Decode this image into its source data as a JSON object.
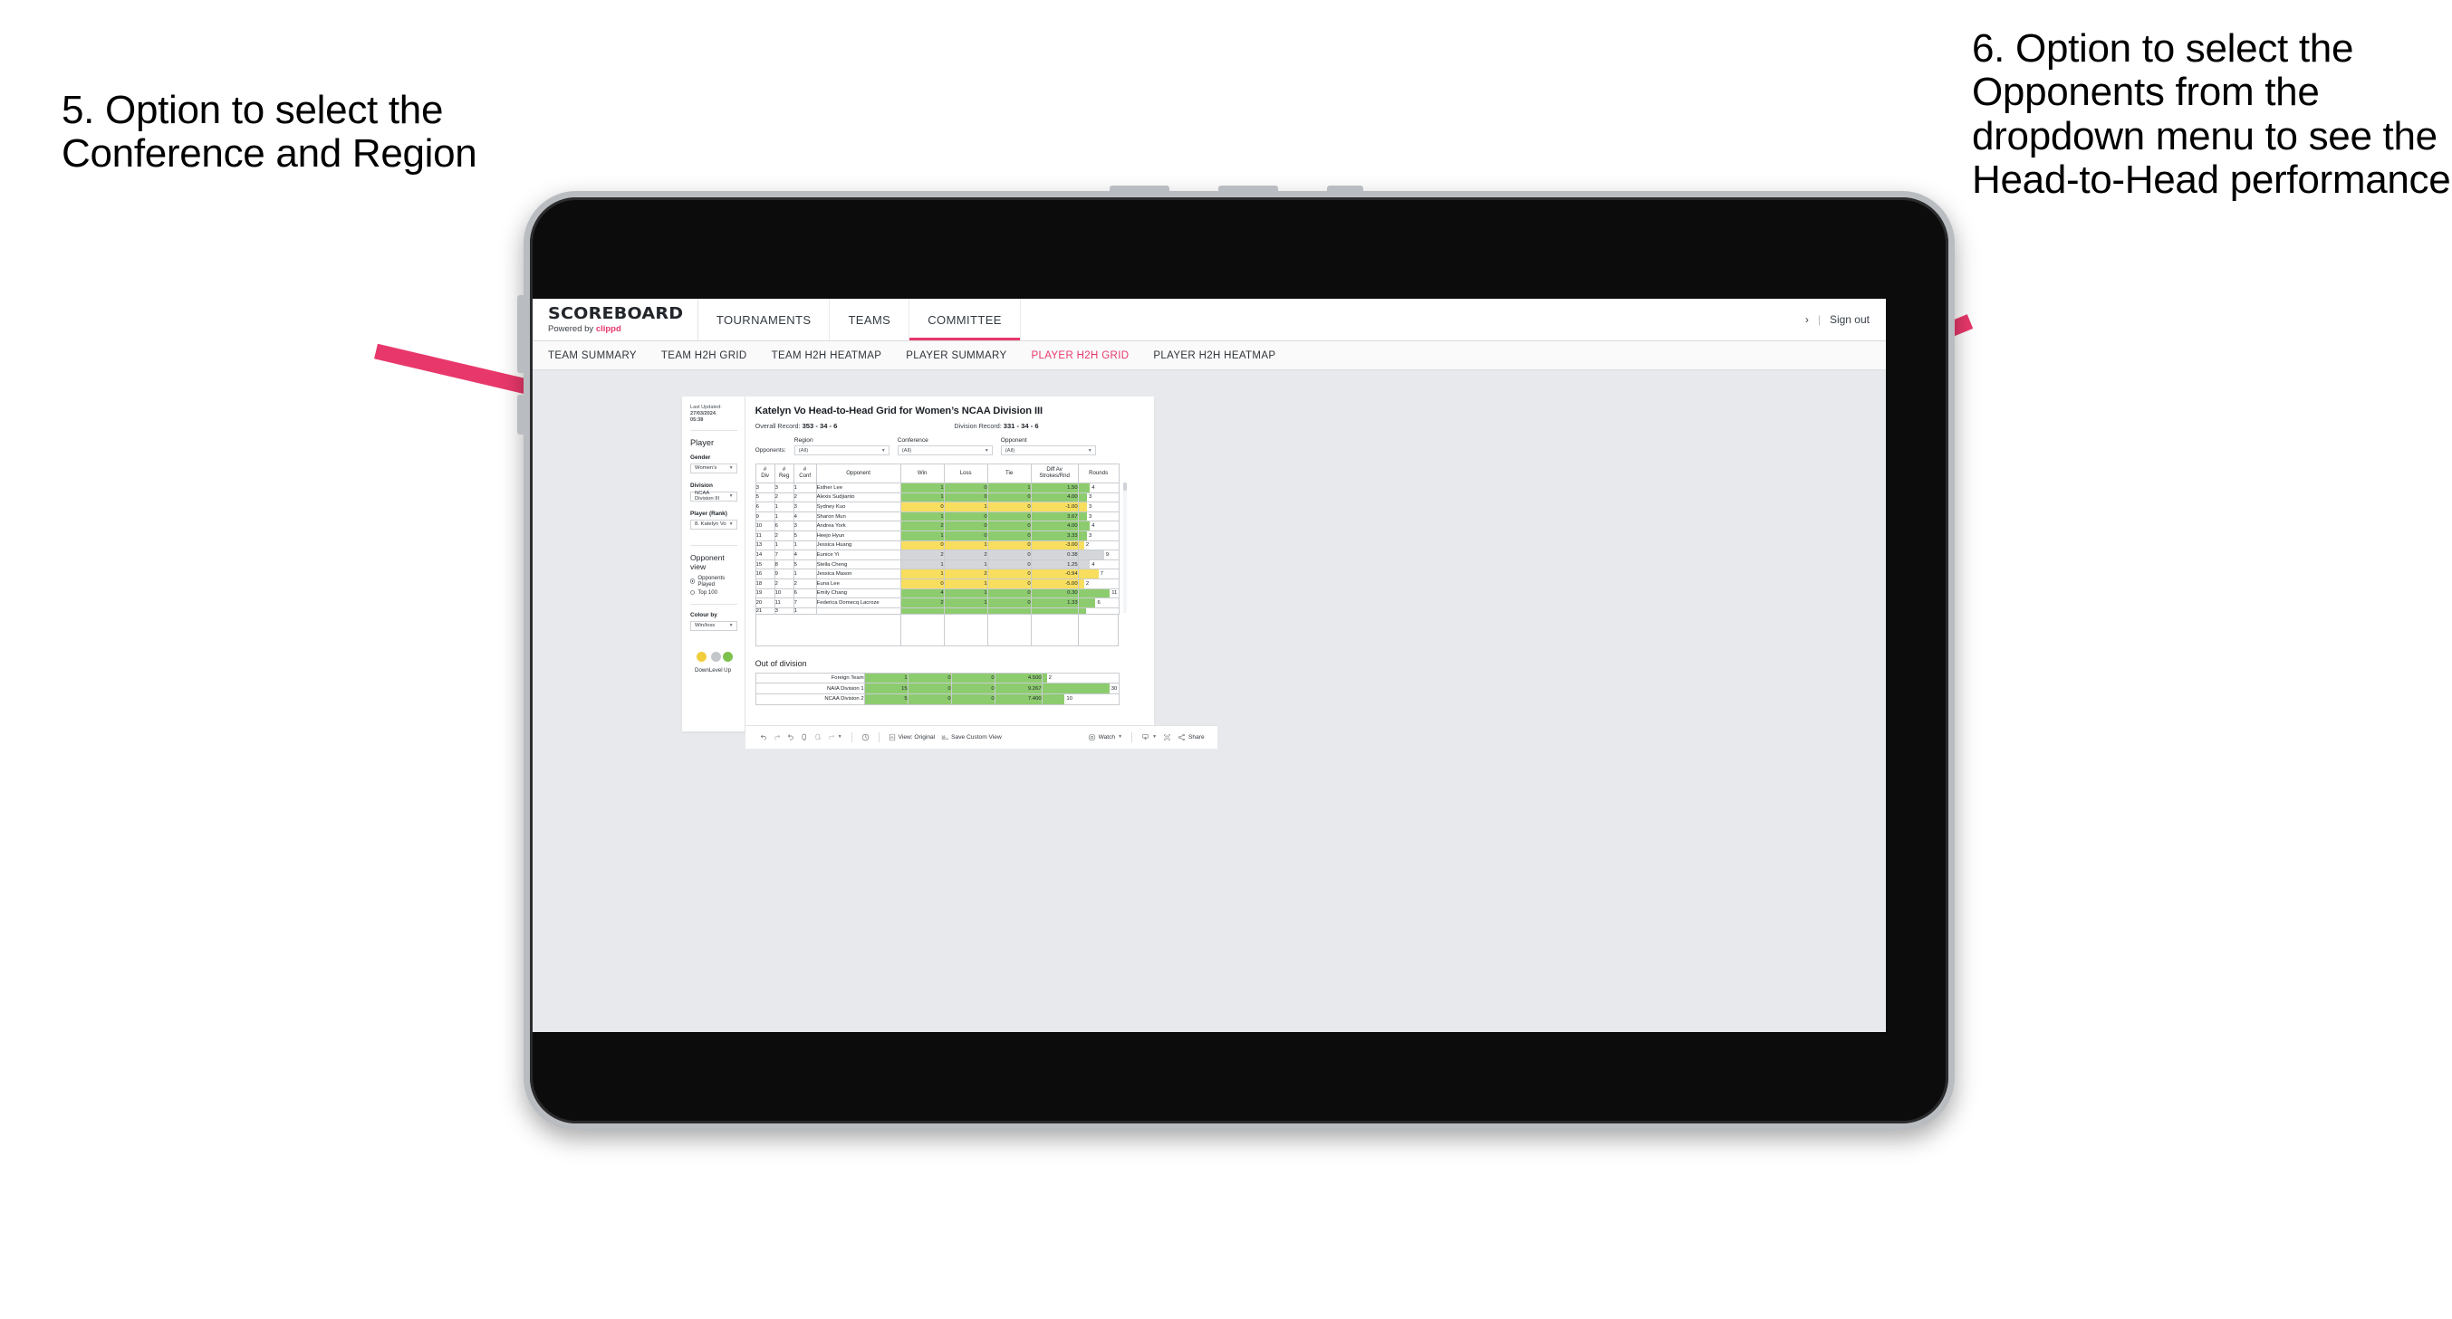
{
  "annotations": {
    "left": "5. Option to select the Conference and Region",
    "right": "6. Option to select the Opponents from the dropdown menu to see the Head-to-Head performance",
    "arrow_color": "#E8386B"
  },
  "app": {
    "brand": {
      "name": "SCOREBOARD",
      "powered_prefix": "Powered by ",
      "powered_brand": "clippd"
    },
    "topnav": [
      {
        "label": "TOURNAMENTS",
        "active": false
      },
      {
        "label": "TEAMS",
        "active": false
      },
      {
        "label": "COMMITTEE",
        "active": true
      }
    ],
    "topright": {
      "chevron": "›",
      "separator": "|",
      "signout": "Sign out"
    },
    "subnav": [
      {
        "label": "TEAM SUMMARY",
        "active": false
      },
      {
        "label": "TEAM H2H GRID",
        "active": false
      },
      {
        "label": "TEAM H2H HEATMAP",
        "active": false
      },
      {
        "label": "PLAYER SUMMARY",
        "active": false
      },
      {
        "label": "PLAYER H2H GRID",
        "active": true
      },
      {
        "label": "PLAYER H2H HEATMAP",
        "active": false
      }
    ]
  },
  "sidebar": {
    "last_updated_label": "Last Updated:",
    "last_updated_value": "27/03/2024",
    "last_updated_time": "05:38",
    "player_heading": "Player",
    "gender_label": "Gender",
    "gender_value": "Women’s",
    "division_label": "Division",
    "division_value": "NCAA Division III",
    "player_rank_label": "Player (Rank)",
    "player_rank_value": "8. Katelyn Vo",
    "opponent_view_heading": "Opponent view",
    "opponent_view_options": [
      {
        "label": "Opponents Played",
        "selected": true
      },
      {
        "label": "Top 100",
        "selected": false
      }
    ],
    "colour_by_label": "Colour by",
    "colour_by_value": "Win/loss",
    "legend": [
      {
        "label": "Down",
        "color": "#F2CE3E"
      },
      {
        "label": "Level",
        "color": "#C3C7CC"
      },
      {
        "label": "Up",
        "color": "#7DC24E"
      }
    ]
  },
  "main": {
    "title": "Katelyn Vo Head-to-Head Grid for Women’s NCAA Division III",
    "overall_record_label": "Overall Record:",
    "overall_record_value": "353 -  34 - 6",
    "division_record_label": "Division Record:",
    "division_record_value": "331 -  34 - 6",
    "opponents_label": "Opponents:",
    "filters": [
      {
        "label": "Region",
        "value": "(All)"
      },
      {
        "label": "Conference",
        "value": "(All)"
      },
      {
        "label": "Opponent",
        "value": "(All)"
      }
    ],
    "out_of_division_heading": "Out of division"
  },
  "chart_data": {
    "type": "table",
    "title": "Katelyn Vo Head-to-Head Grid for Women’s NCAA Division III",
    "columns": [
      "# Div",
      "# Reg",
      "# Conf",
      "Opponent",
      "Win",
      "Loss",
      "Tie",
      "Diff Av Strokes/Rnd",
      "Rounds"
    ],
    "header_lines": {
      "div": [
        "#",
        "Div"
      ],
      "reg": [
        "#",
        "Reg"
      ],
      "conf": [
        "#",
        "Conf"
      ],
      "opponent": [
        "Opponent"
      ],
      "win": [
        "Win"
      ],
      "loss": [
        "Loss"
      ],
      "tie": [
        "Tie"
      ],
      "diff": [
        "Diff Av",
        "Strokes/Rnd"
      ],
      "rounds": [
        "Rounds"
      ]
    },
    "rounds_max": 14,
    "rows": [
      {
        "div": "3",
        "reg": "3",
        "conf": "1",
        "opponent": "Esther Lee",
        "win": "1",
        "loss": "0",
        "tie": "1",
        "diff": "1.50",
        "rounds": "4",
        "rounds_num": 4,
        "state": "up"
      },
      {
        "div": "5",
        "reg": "2",
        "conf": "2",
        "opponent": "Alexis Sudjianto",
        "win": "1",
        "loss": "0",
        "tie": "0",
        "diff": "4.00",
        "rounds": "3",
        "rounds_num": 3,
        "state": "up"
      },
      {
        "div": "6",
        "reg": "1",
        "conf": "3",
        "opponent": "Sydney Kuo",
        "win": "0",
        "loss": "1",
        "tie": "0",
        "diff": "-1.00",
        "rounds": "3",
        "rounds_num": 3,
        "state": "down"
      },
      {
        "div": "9",
        "reg": "1",
        "conf": "4",
        "opponent": "Sharon Mun",
        "win": "1",
        "loss": "0",
        "tie": "0",
        "diff": "3.67",
        "rounds": "3",
        "rounds_num": 3,
        "state": "up"
      },
      {
        "div": "10",
        "reg": "6",
        "conf": "3",
        "opponent": "Andrea York",
        "win": "2",
        "loss": "0",
        "tie": "0",
        "diff": "4.00",
        "rounds": "4",
        "rounds_num": 4,
        "state": "up"
      },
      {
        "div": "11",
        "reg": "2",
        "conf": "5",
        "opponent": "Heejo Hyun",
        "win": "1",
        "loss": "0",
        "tie": "0",
        "diff": "3.33",
        "rounds": "3",
        "rounds_num": 3,
        "state": "up"
      },
      {
        "div": "13",
        "reg": "1",
        "conf": "1",
        "opponent": "Jessica Huang",
        "win": "0",
        "loss": "1",
        "tie": "0",
        "diff": "-3.00",
        "rounds": "2",
        "rounds_num": 2,
        "state": "down"
      },
      {
        "div": "14",
        "reg": "7",
        "conf": "4",
        "opponent": "Eunice Yi",
        "win": "2",
        "loss": "2",
        "tie": "0",
        "diff": "0.38",
        "rounds": "9",
        "rounds_num": 9,
        "state": "level"
      },
      {
        "div": "15",
        "reg": "8",
        "conf": "5",
        "opponent": "Stella Cheng",
        "win": "1",
        "loss": "1",
        "tie": "0",
        "diff": "1.25",
        "rounds": "4",
        "rounds_num": 4,
        "state": "level"
      },
      {
        "div": "16",
        "reg": "9",
        "conf": "1",
        "opponent": "Jessica Mason",
        "win": "1",
        "loss": "2",
        "tie": "0",
        "diff": "-0.94",
        "rounds": "7",
        "rounds_num": 7,
        "state": "down"
      },
      {
        "div": "18",
        "reg": "2",
        "conf": "2",
        "opponent": "Euna Lee",
        "win": "0",
        "loss": "1",
        "tie": "0",
        "diff": "-5.00",
        "rounds": "2",
        "rounds_num": 2,
        "state": "down"
      },
      {
        "div": "19",
        "reg": "10",
        "conf": "6",
        "opponent": "Emily Chang",
        "win": "4",
        "loss": "1",
        "tie": "0",
        "diff": "0.30",
        "rounds": "11",
        "rounds_num": 11,
        "state": "up"
      },
      {
        "div": "20",
        "reg": "11",
        "conf": "7",
        "opponent": "Federica Domecq Lacroze",
        "win": "2",
        "loss": "1",
        "tie": "0",
        "diff": "1.33",
        "rounds": "6",
        "rounds_num": 6,
        "state": "up"
      }
    ],
    "out_of_division": {
      "rounds_max": 34,
      "rows": [
        {
          "name": "Foreign Team",
          "win": "1",
          "loss": "0",
          "tie": "0",
          "diff": "4.500",
          "rounds": "2",
          "rounds_num": 2,
          "state": "up"
        },
        {
          "name": "NAIA Division 1",
          "win": "15",
          "loss": "0",
          "tie": "0",
          "diff": "9.267",
          "rounds": "30",
          "rounds_num": 30,
          "state": "up"
        },
        {
          "name": "NCAA Division 2",
          "win": "5",
          "loss": "0",
          "tie": "0",
          "diff": "7.400",
          "rounds": "10",
          "rounds_num": 10,
          "state": "up"
        }
      ]
    },
    "colors": {
      "up": "#8DCC6E",
      "down": "#F7DE5E",
      "level": "#D4D6D9",
      "grid": "#C9CCD0"
    }
  },
  "toolbar": {
    "icons": [
      "undo-icon",
      "redo-icon",
      "revert-icon",
      "refresh-data-icon",
      "pause-updates-icon",
      "share-loop-icon"
    ],
    "view_label": "View: Original",
    "save_custom_view_label": "Save Custom View",
    "watch_label": "Watch",
    "download_label": "download-icon",
    "fullscreen_label": "fullscreen-icon",
    "share_label": "Share"
  }
}
